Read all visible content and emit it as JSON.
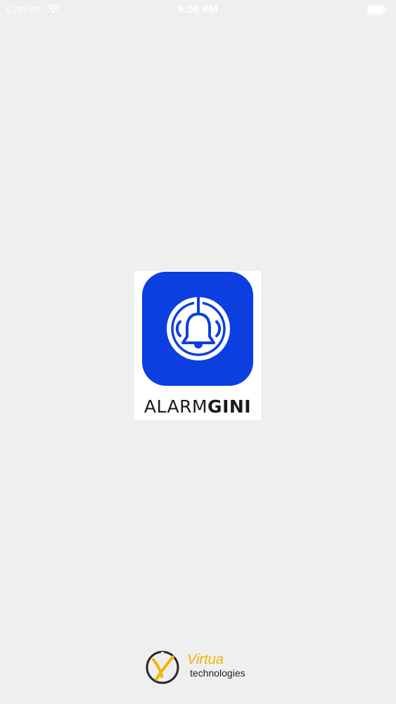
{
  "status_bar": {
    "carrier": "Carrier",
    "time": "6:06 PM",
    "icons": [
      "wifi-icon",
      "battery-icon"
    ]
  },
  "splash": {
    "app_name_light": "ALARM",
    "app_name_bold": "GINI",
    "app_icon": "bell-icon",
    "brand_color": "#0b3fe0"
  },
  "footer": {
    "company_name": "Virtua",
    "company_tagline": "technologies",
    "company_logo": "virtua-logo-icon",
    "accent_color": "#f2b400"
  }
}
